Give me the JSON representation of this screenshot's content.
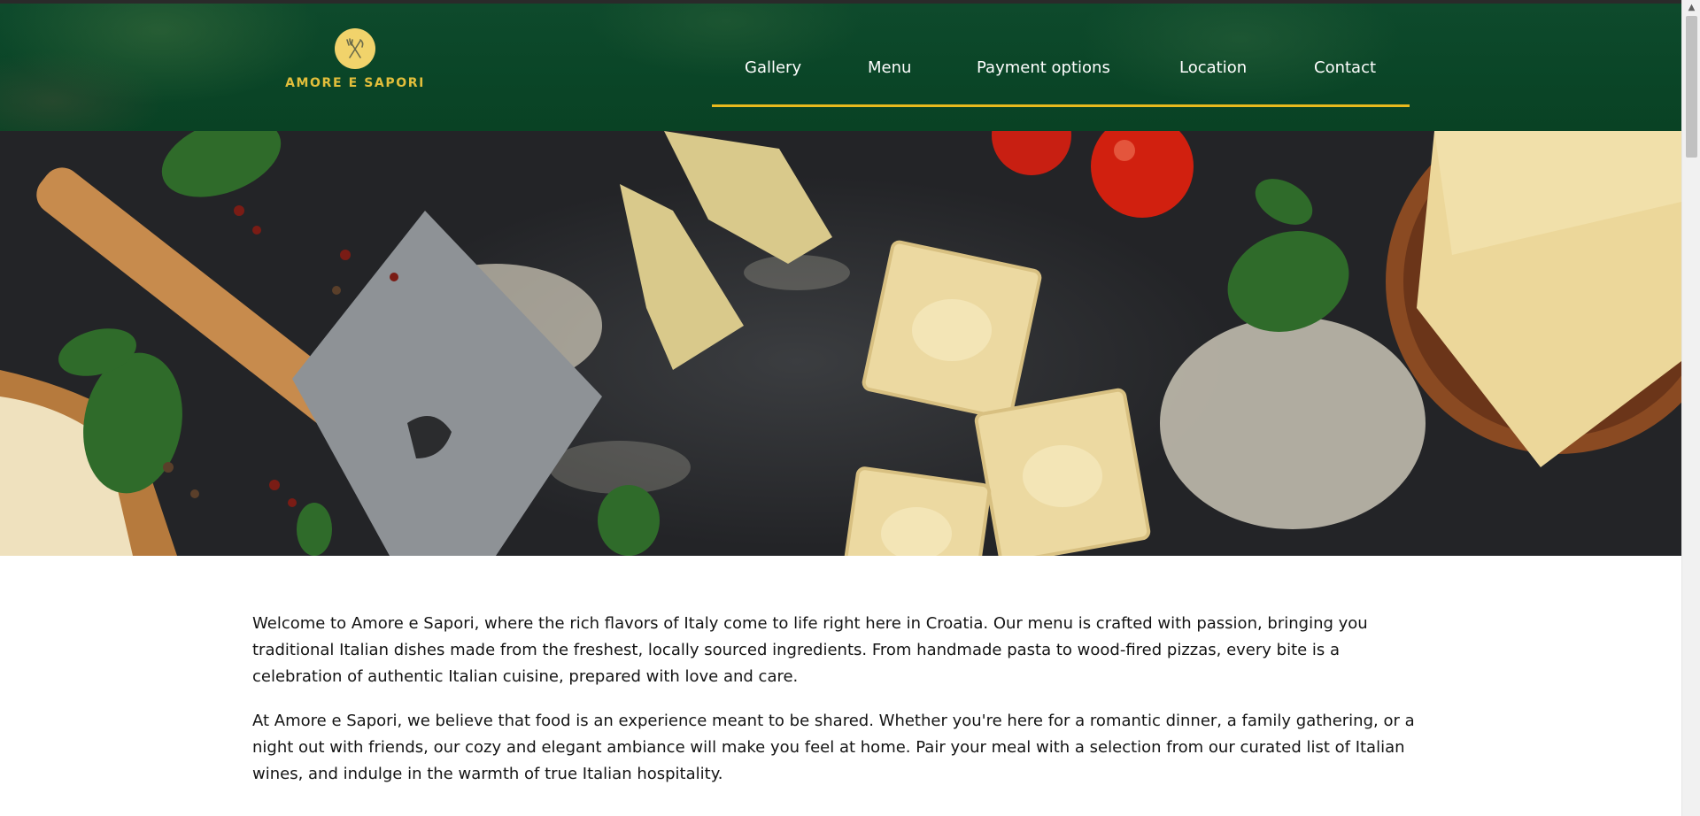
{
  "brand": {
    "name": "AMORE E SAPORI",
    "logo_icon": "fork-knife-icon",
    "logo_color": "#f1d36b",
    "text_color": "#e3bf3b"
  },
  "nav": {
    "items": [
      {
        "label": "Gallery"
      },
      {
        "label": "Menu"
      },
      {
        "label": "Payment options"
      },
      {
        "label": "Location"
      },
      {
        "label": "Contact"
      }
    ],
    "underline_color": "#e8b91e"
  },
  "header": {
    "background_color": "#0a4527"
  },
  "hero": {
    "image": "italian-pasta-hero-image"
  },
  "content": {
    "paragraphs": [
      "Welcome to Amore e Sapori, where the rich flavors of Italy come to life right here in Croatia. Our menu is crafted with passion, bringing you traditional Italian dishes made from the freshest, locally sourced ingredients. From handmade pasta to wood-fired pizzas, every bite is a celebration of authentic Italian cuisine, prepared with love and care.",
      "At Amore e Sapori, we believe that food is an experience meant to be shared. Whether you're here for a romantic dinner, a family gathering, or a night out with friends, our cozy and elegant ambiance will make you feel at home. Pair your meal with a selection from our curated list of Italian wines, and indulge in the warmth of true Italian hospitality."
    ]
  },
  "scrollbar": {
    "up_icon": "chevron-up-icon"
  }
}
